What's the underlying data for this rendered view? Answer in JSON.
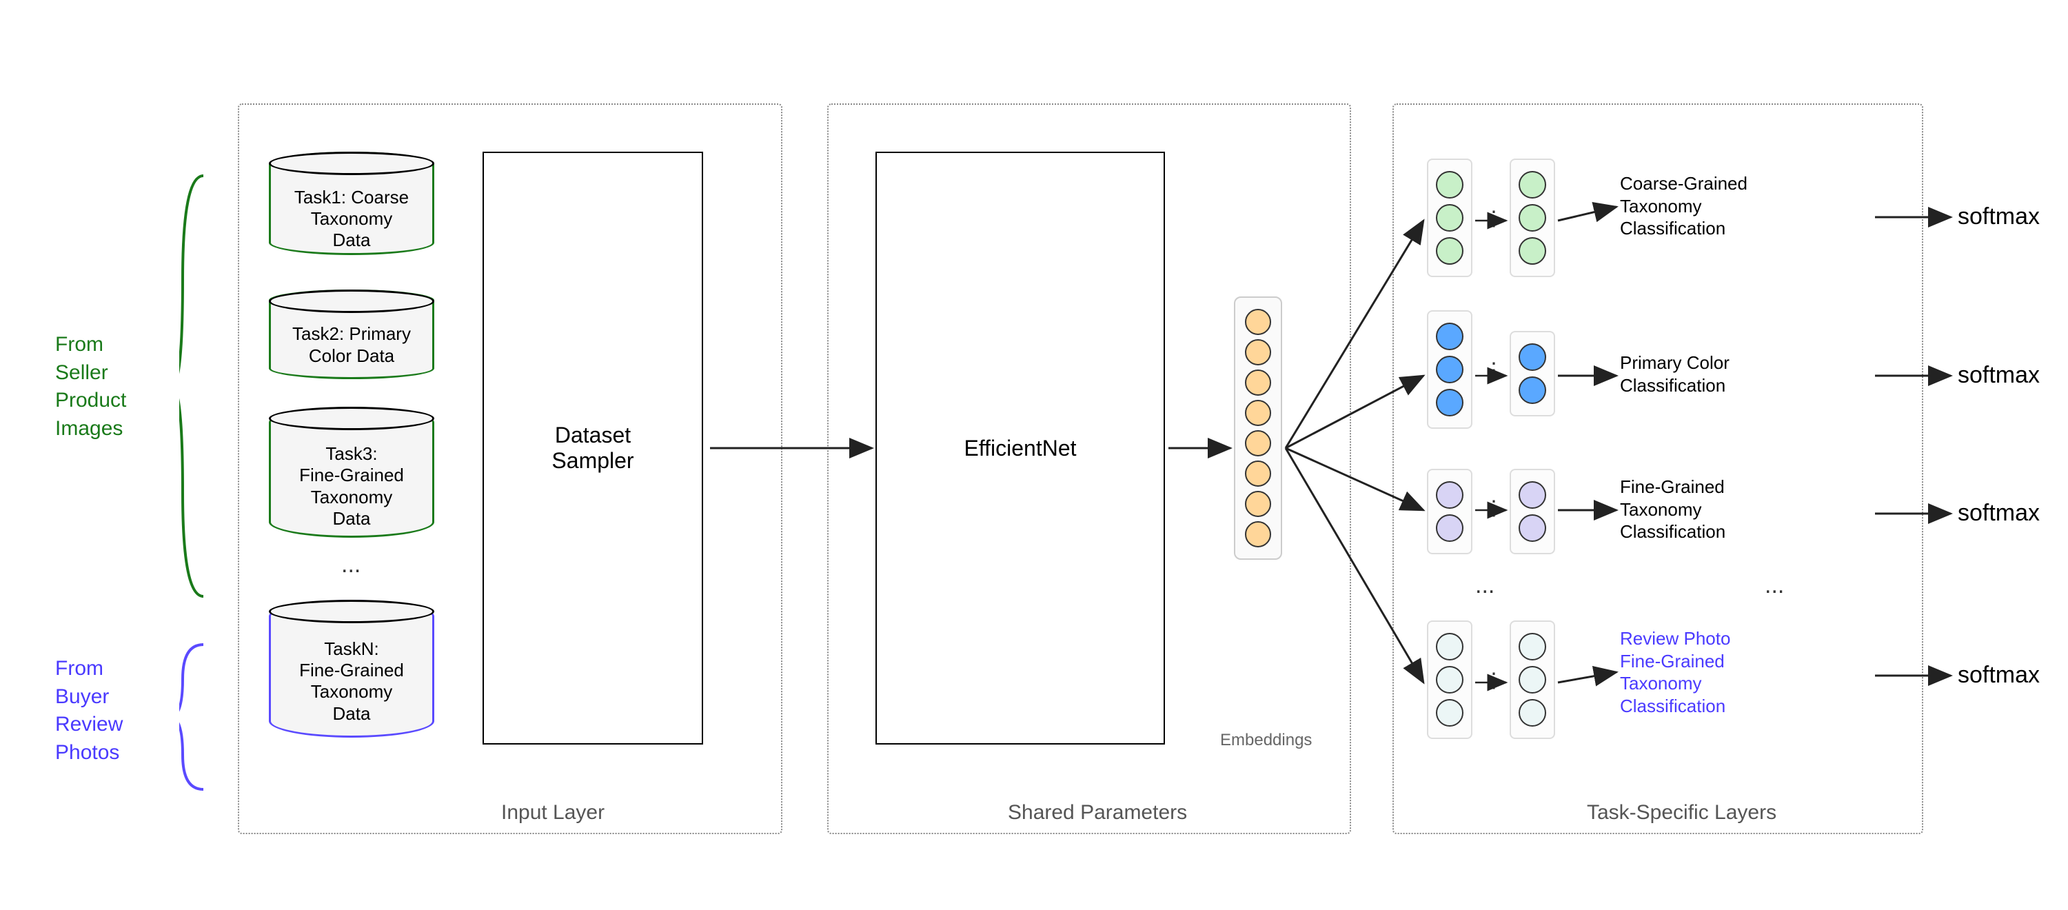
{
  "side_labels": {
    "seller": "From\nSeller\nProduct\nImages",
    "buyer": "From\nBuyer\nReview\nPhotos"
  },
  "cylinders": {
    "task1": "Task1: Coarse\nTaxonomy\nData",
    "task2": "Task2: Primary\nColor Data",
    "task3": "Task3:\nFine-Grained\nTaxonomy\nData",
    "taskN": "TaskN:\nFine-Grained\nTaxonomy\nData"
  },
  "boxes": {
    "sampler": "Dataset\nSampler",
    "backbone": "EfficientNet"
  },
  "labels": {
    "embeddings": "Embeddings",
    "input_layer": "Input Layer",
    "shared": "Shared Parameters",
    "task_specific": "Task-Specific Layers"
  },
  "task_outputs": {
    "coarse": "Coarse-Grained\nTaxonomy\nClassification",
    "primary": "Primary Color\nClassification",
    "fine": "Fine-Grained\nTaxonomy\nClassification",
    "review": "Review Photo\nFine-Grained\nTaxonomy\nClassification"
  },
  "softmax": "softmax",
  "ellipsis": "...",
  "ellipsis_v": "⋮"
}
